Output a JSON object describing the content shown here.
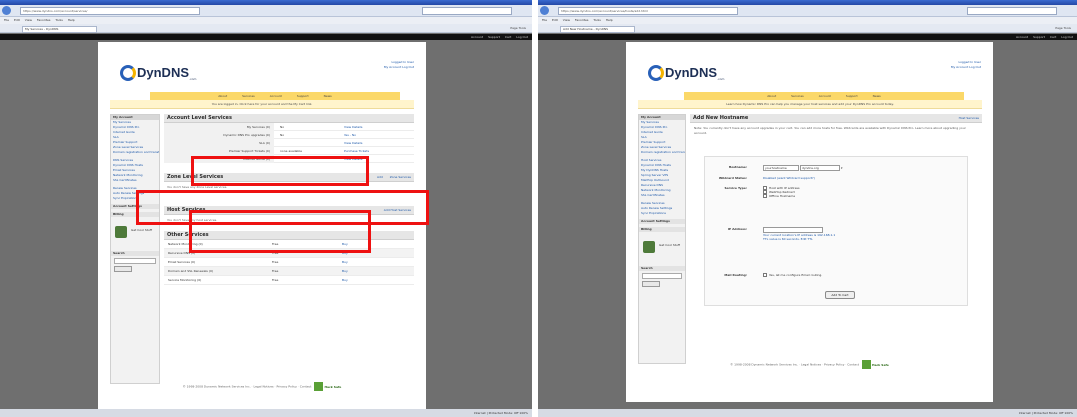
{
  "left": {
    "browser": {
      "url": "https://www.dyndns.com/account/services/",
      "tab": "My Services - DynDNS",
      "menu": [
        "File",
        "Edit",
        "View",
        "Favorites",
        "Tools",
        "Help"
      ],
      "tools": "Page  Tools"
    },
    "topbar_links": [
      "Account",
      "Support",
      "Cart",
      "Log Out"
    ],
    "logo": {
      "text": "DynDNS",
      "suffix": ".com"
    },
    "header_links": [
      "Logged In User",
      "My Account  Log Out"
    ],
    "nav": [
      "About",
      "Services",
      "Account",
      "Support",
      "News"
    ],
    "notice": "You are logged in. Click here for your account and the My Cart link.",
    "sidebar": {
      "title": "My Account",
      "items": [
        "My Services",
        "Dynamic DNS Pro",
        "Internet Guide",
        "SLA",
        "Premier Support",
        "Zone Level Services",
        "Domain registration and transfer",
        "DNS Services",
        "Dynamic DNS Hosts",
        "Email Services",
        "Network Monitoring",
        "SSL Certificates",
        "Renew Services",
        "Auto Renew Settings",
        "Sync Expirations"
      ],
      "sec1": "Account Settings",
      "sec2": "Billing",
      "promo": "Get Cool Stuff",
      "sec3": "Search",
      "search_btn": "Search"
    },
    "account_services": {
      "title": "Account Level Services",
      "rows": [
        {
          "label": "My Services (0)",
          "v1": "No",
          "v2": "View Details"
        },
        {
          "label": "Dynamic DNS Pro upgrades (0)",
          "v1": "No",
          "v2": "Yes - No"
        },
        {
          "label": "SLA (0)",
          "v1": "",
          "v2": "View Details"
        },
        {
          "label": "Premier Support Tickets (0)",
          "v1": "none available",
          "v2": "Purchase Tickets"
        },
        {
          "label": "Internet Guide (0)",
          "v1": "",
          "v2": "View Details"
        }
      ]
    },
    "zone_services": {
      "title": "Zone Level Services",
      "links": [
        "Add",
        "Zone Services"
      ],
      "note": "You don't have any Zone Level services."
    },
    "host_services": {
      "title": "Host Services",
      "link": "Add Host Services",
      "note": "You don't have any host services."
    },
    "other_services": {
      "title": "Other Services",
      "rows": [
        {
          "name": "Network Monitoring (0)",
          "price": "Free",
          "buy": "Buy"
        },
        {
          "name": "Recursive DNS (0)",
          "price": "Free",
          "buy": "Buy"
        },
        {
          "name": "Email Services (0)",
          "price": "Free",
          "buy": "Buy"
        },
        {
          "name": "Domain and SSL Renewals (0)",
          "price": "Free",
          "buy": "Buy"
        },
        {
          "name": "Service Monitoring (0)",
          "price": "Free",
          "buy": "Buy"
        }
      ]
    },
    "footer": {
      "text": "© 1998-2008 Dynamic Network Services Inc. · Legal Notices · Privacy Policy · Contact",
      "badge": "Hack Safe"
    },
    "status": "Internet | Protected Mode: Off   100%"
  },
  "right": {
    "browser": {
      "url": "https://www.dyndns.com/account/services/hosts/add.html",
      "tab": "Add New Hostname - DynDNS",
      "menu": [
        "File",
        "Edit",
        "View",
        "Favorites",
        "Tools",
        "Help"
      ],
      "tools": "Page  Tools"
    },
    "topbar_links": [
      "Account",
      "Support",
      "Cart",
      "Log Out"
    ],
    "logo": {
      "text": "DynDNS",
      "suffix": ".com"
    },
    "header_links": [
      "Logged In User",
      "My Account  Log Out"
    ],
    "nav": [
      "About",
      "Services",
      "Account",
      "Support",
      "News"
    ],
    "notice": "Learn how Dynamic DNS Pro can help you manage your host services and add your DynDNS Pro account today.",
    "sidebar": {
      "title": "My Account",
      "items": [
        "My Services",
        "Dynamic DNS Pro",
        "Internet Guide",
        "SLA",
        "Premier Support",
        "Zone Level Services",
        "Domain registration and transfer",
        "Host Services",
        "Dynamic DNS Hosts",
        "My DynDNS Hosts",
        "Spring Server VPS",
        "MailHop Outbound",
        "Recursive DNS",
        "Network Monitoring",
        "SSL Certificates",
        "Renew Services",
        "Auto Renew Settings",
        "Sync Expirations"
      ],
      "sec1": "Account Settings",
      "sec2": "Billing",
      "promo": "Get Cool Stuff",
      "sec3": "Search",
      "search_btn": "Search"
    },
    "form": {
      "title": "Add New Hostname",
      "link": "Host Services",
      "intro": "Note: You currently don't have any account upgrades in your cart. You can add more hosts for free. Wildcards are available with Dynamic DNS Pro. Learn more about upgrading your account.",
      "hostname_label": "Hostname:",
      "hostname_value": "yourhostname",
      "domain_value": "dyndns.org",
      "wildcard_label": "Wildcard Status:",
      "wildcard_value": "Disabled (want Wildcard support?)",
      "service_label": "Service Type:",
      "service_options": [
        "Host with IP address",
        "WebHop Redirect",
        "Offline Hostname"
      ],
      "ip_label": "IP Address:",
      "ip_detected": "Your current location's IP address is 192.168.1.1",
      "ip_ttl": "TTL value is 60 seconds. Edit TTL",
      "mx_label": "Mail Routing:",
      "mx_value": "Yes, let me configure Email routing.",
      "submit": "Add To Cart"
    },
    "footer": {
      "text": "© 1998-2008 Dynamic Network Services Inc. · Legal Notices · Privacy Policy · Contact",
      "badge": "Hack Safe"
    },
    "status": "Internet | Protected Mode: Off   100%"
  }
}
